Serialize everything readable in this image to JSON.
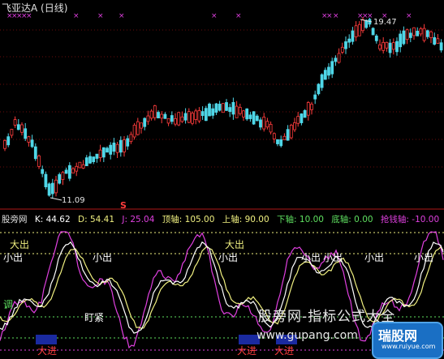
{
  "header": {
    "title": "飞亚达A (日线)",
    "high_label": "19.47",
    "low_label": "11.09",
    "s_marker": "S"
  },
  "indicator": {
    "name": "股旁网",
    "k": "K: 44.62",
    "d": "D: 54.41",
    "j": "J: 25.04",
    "top_axis": "顶轴: 105.00",
    "upper_axis": "上轴: 90.00",
    "lower_axis": "下轴: 10.00",
    "bottom_axis": "底轴: 0.00",
    "rescue_axis": "抢钱轴: -10.00"
  },
  "signals": {
    "big_out": "大出",
    "small_out": "小出",
    "big_in": "大进",
    "adjust": "调",
    "tight": "盯紧"
  },
  "watermark": {
    "cn": "股旁网-指标公式大全",
    "url": "www.gupang.com",
    "logo": "瑞股网",
    "logo_url": "www.ruiyue.com"
  },
  "colors": {
    "up": "#ff3c3c",
    "down": "#4fd7e8",
    "k_line": "#ffffff",
    "d_line": "#f0f080",
    "j_line": "#e040e0",
    "grid": "#7f1010"
  }
}
